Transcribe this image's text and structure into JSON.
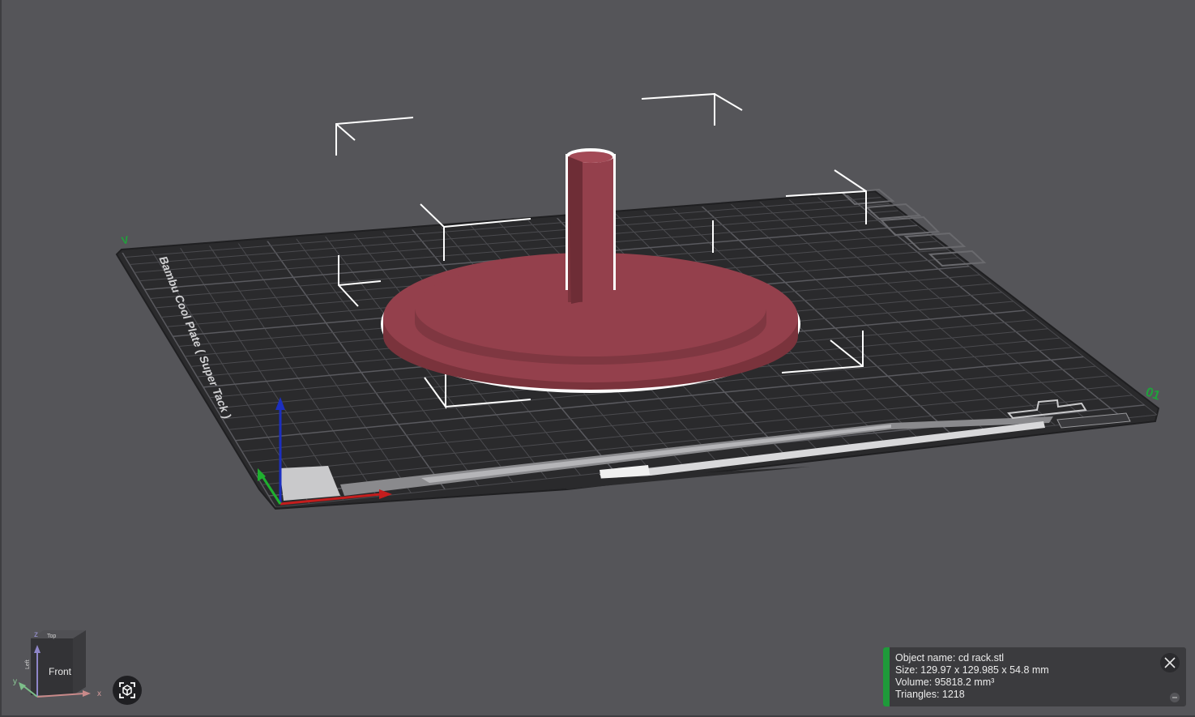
{
  "bed": {
    "plate_name": "Bambu Cool Plate ( Super Tack )",
    "label_left": "V",
    "label_right": "01"
  },
  "object_info": {
    "name_line": "Object name: cd rack.stl",
    "size_line": "Size: 129.97 x 129.985 x 54.8 mm",
    "volume_line": "Volume: 95818.2 mm³",
    "triangles_line": "Triangles: 1218"
  },
  "view_cube": {
    "front_label": "Front",
    "top_label": "Top",
    "left_label": "Left",
    "axis_x": "x",
    "axis_y": "y",
    "axis_z": "z"
  },
  "colors": {
    "background": "#555559",
    "bed": "#2b2b2d",
    "model": "#94404c",
    "accent": "#1f9a3a"
  },
  "icons": {
    "fit_view": "fit-view-icon",
    "close": "close-icon",
    "collapse": "collapse-icon"
  }
}
